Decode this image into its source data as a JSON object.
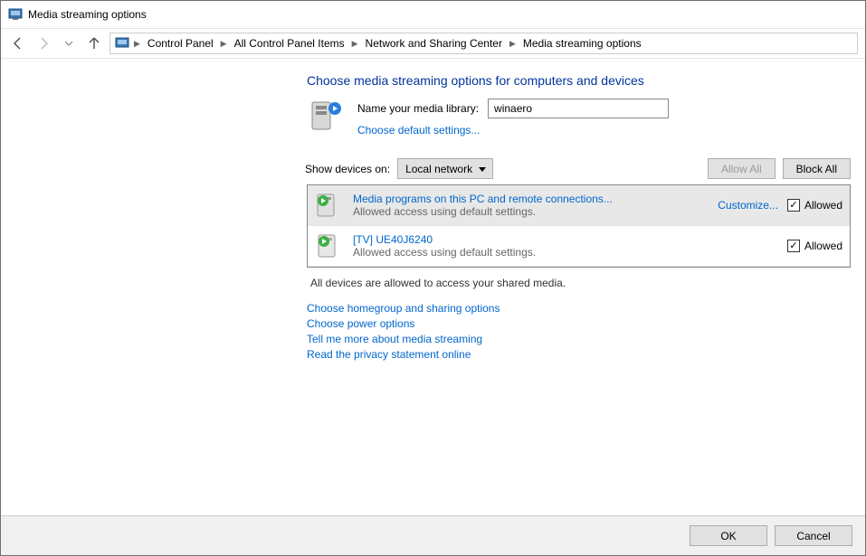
{
  "window": {
    "title": "Media streaming options"
  },
  "breadcrumb": {
    "items": [
      "Control Panel",
      "All Control Panel Items",
      "Network and Sharing Center",
      "Media streaming options"
    ]
  },
  "main": {
    "heading": "Choose media streaming options for computers and devices",
    "library_label": "Name your media library:",
    "library_value": "winaero",
    "choose_default": "Choose default settings...",
    "show_devices_label": "Show devices on:",
    "show_devices_value": "Local network",
    "allow_all": "Allow All",
    "block_all": "Block All",
    "devices": [
      {
        "title": "Media programs on this PC and remote connections...",
        "sub": "Allowed access using default settings.",
        "customize": "Customize...",
        "allowed_label": "Allowed"
      },
      {
        "title": "[TV] UE40J6240",
        "sub": "Allowed access using default settings.",
        "customize": "",
        "allowed_label": "Allowed"
      }
    ],
    "status": "All devices are allowed to access your shared media.",
    "links": [
      "Choose homegroup and sharing options",
      "Choose power options",
      "Tell me more about media streaming",
      "Read the privacy statement online"
    ]
  },
  "footer": {
    "ok": "OK",
    "cancel": "Cancel"
  }
}
